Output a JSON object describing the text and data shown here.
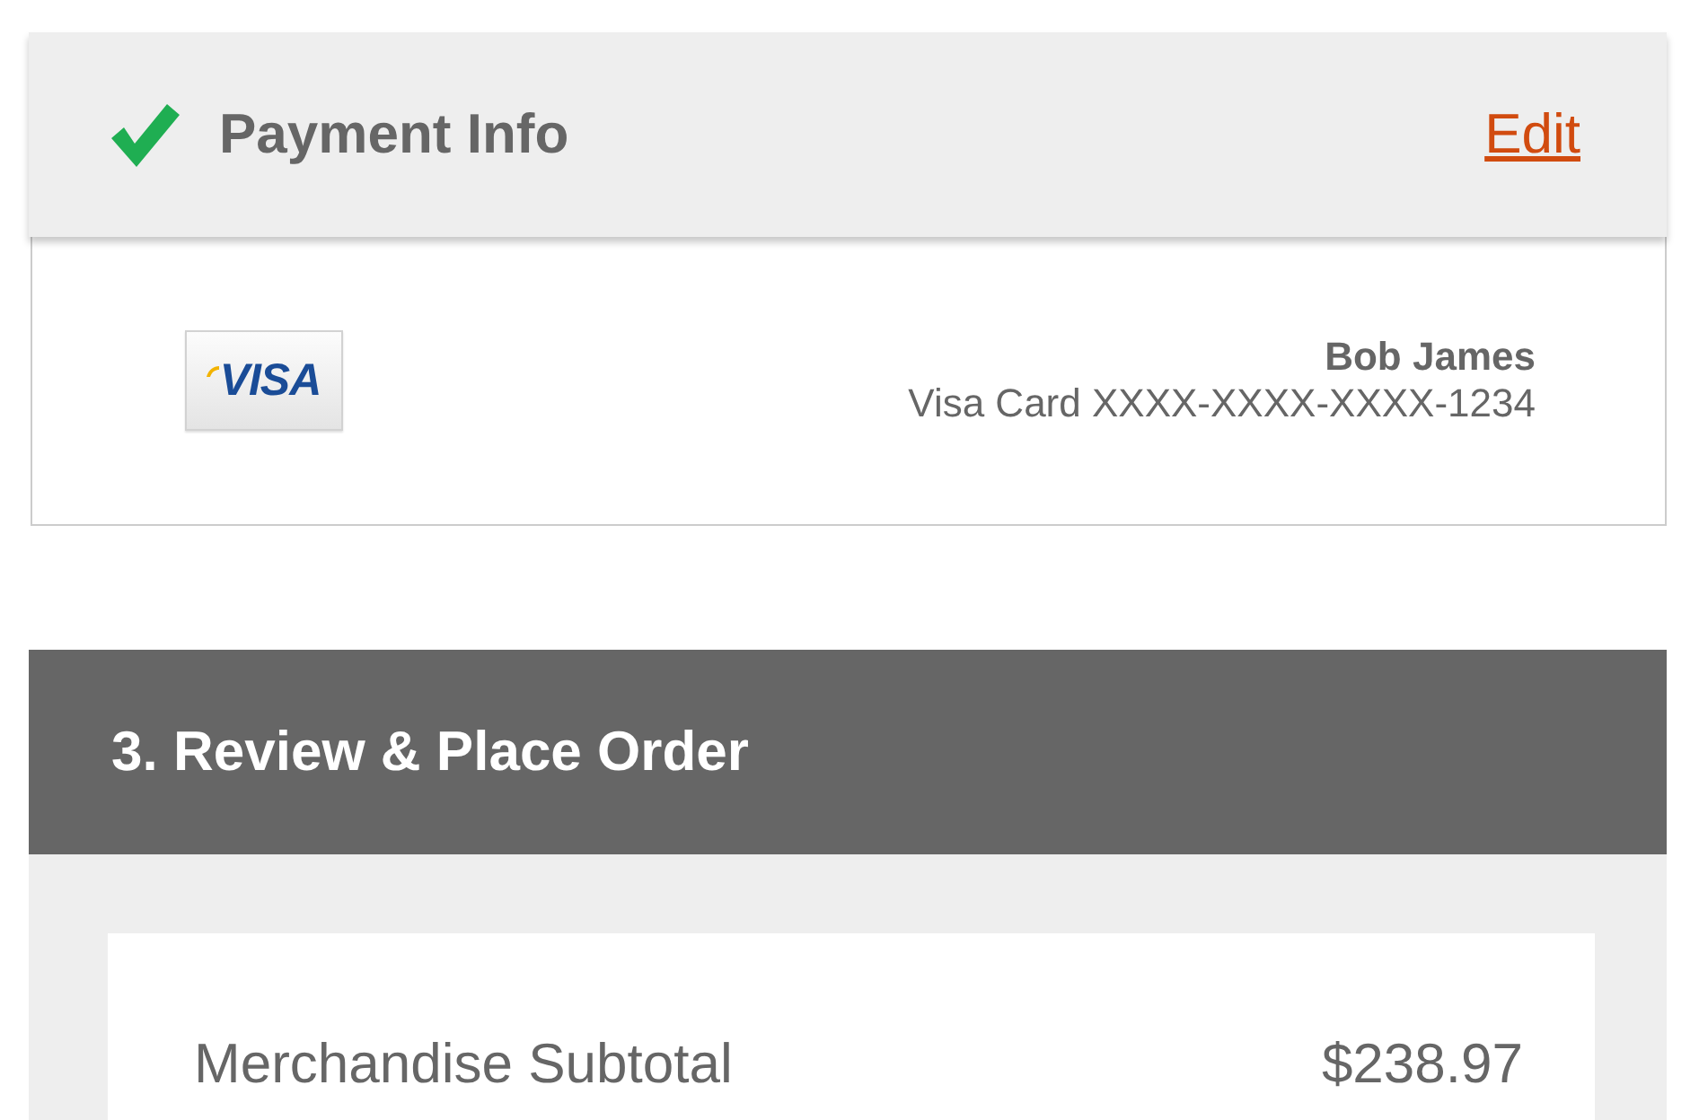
{
  "payment_section": {
    "title": "Payment Info",
    "completed": true,
    "edit_link": "Edit"
  },
  "payment_card": {
    "logo_text": "VISA",
    "cardholder": "Bob James",
    "card_description": "Visa Card XXXX-XXXX-XXXX-1234"
  },
  "review_section": {
    "title": "3. Review & Place Order"
  },
  "summary_rows": [
    {
      "label": "Merchandise Subtotal",
      "value": "$238.97"
    }
  ]
}
